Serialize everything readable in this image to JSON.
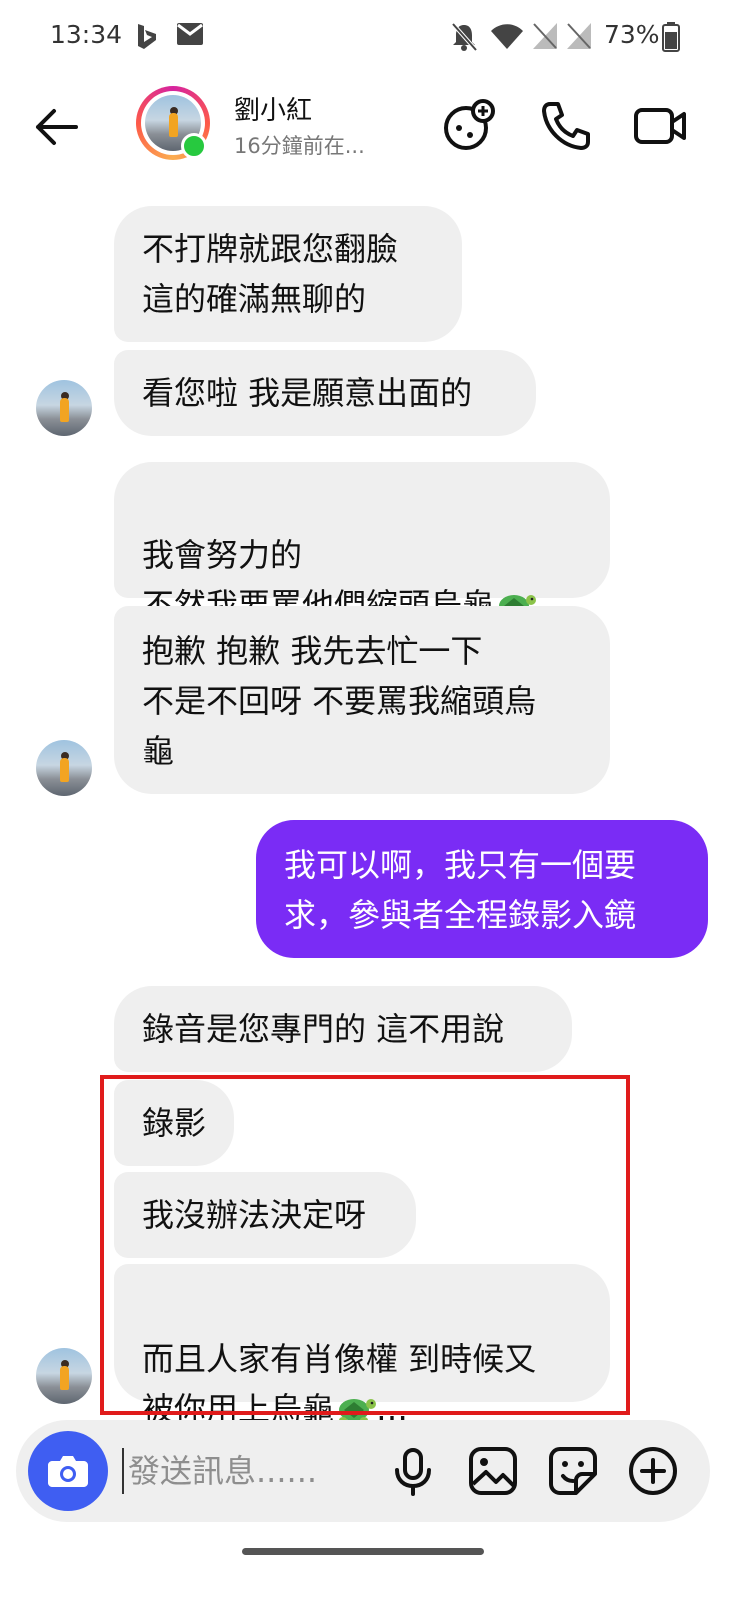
{
  "status_bar": {
    "time": "13:34",
    "battery": "73%"
  },
  "header": {
    "contact_name": "劉小紅",
    "contact_status": "16分鐘前在..."
  },
  "messages": [
    {
      "direction": "in",
      "text": "不打牌就跟您翻臉\n這的確滿無聊的"
    },
    {
      "direction": "in",
      "text": "看您啦 我是願意出面的"
    },
    {
      "direction": "in",
      "text": "我會努力的\n不然我要罵他們縮頭烏龜",
      "emoji": "turtle"
    },
    {
      "direction": "in",
      "text": "抱歉 抱歉 我先去忙一下\n不是不回呀 不要罵我縮頭烏\n龜"
    },
    {
      "direction": "out",
      "text": "我可以啊，我只有一個要\n求，參與者全程錄影入鏡"
    },
    {
      "direction": "in",
      "text": "錄音是您專門的 這不用說"
    },
    {
      "direction": "in",
      "text": "錄影"
    },
    {
      "direction": "in",
      "text": "我沒辦法決定呀"
    },
    {
      "direction": "in",
      "text_line1": "而且人家有肖像權 到時候又",
      "text_line2_prefix": "被你用上烏龜",
      "text_line2_suffix": "…",
      "emoji": "turtle"
    }
  ],
  "composer": {
    "placeholder": "發送訊息......"
  },
  "colors": {
    "outgoing_bubble": "#7a2cf5",
    "incoming_bubble": "#efefef",
    "camera_button": "#3f5ef2",
    "highlight_box": "#e01b1b",
    "online": "#27c93f"
  },
  "icons": {
    "header": [
      "back-arrow-icon",
      "game-controller-icon",
      "phone-icon",
      "video-camera-icon"
    ],
    "composer": [
      "camera-icon",
      "microphone-icon",
      "image-icon",
      "sticker-icon",
      "plus-circle-icon"
    ]
  }
}
